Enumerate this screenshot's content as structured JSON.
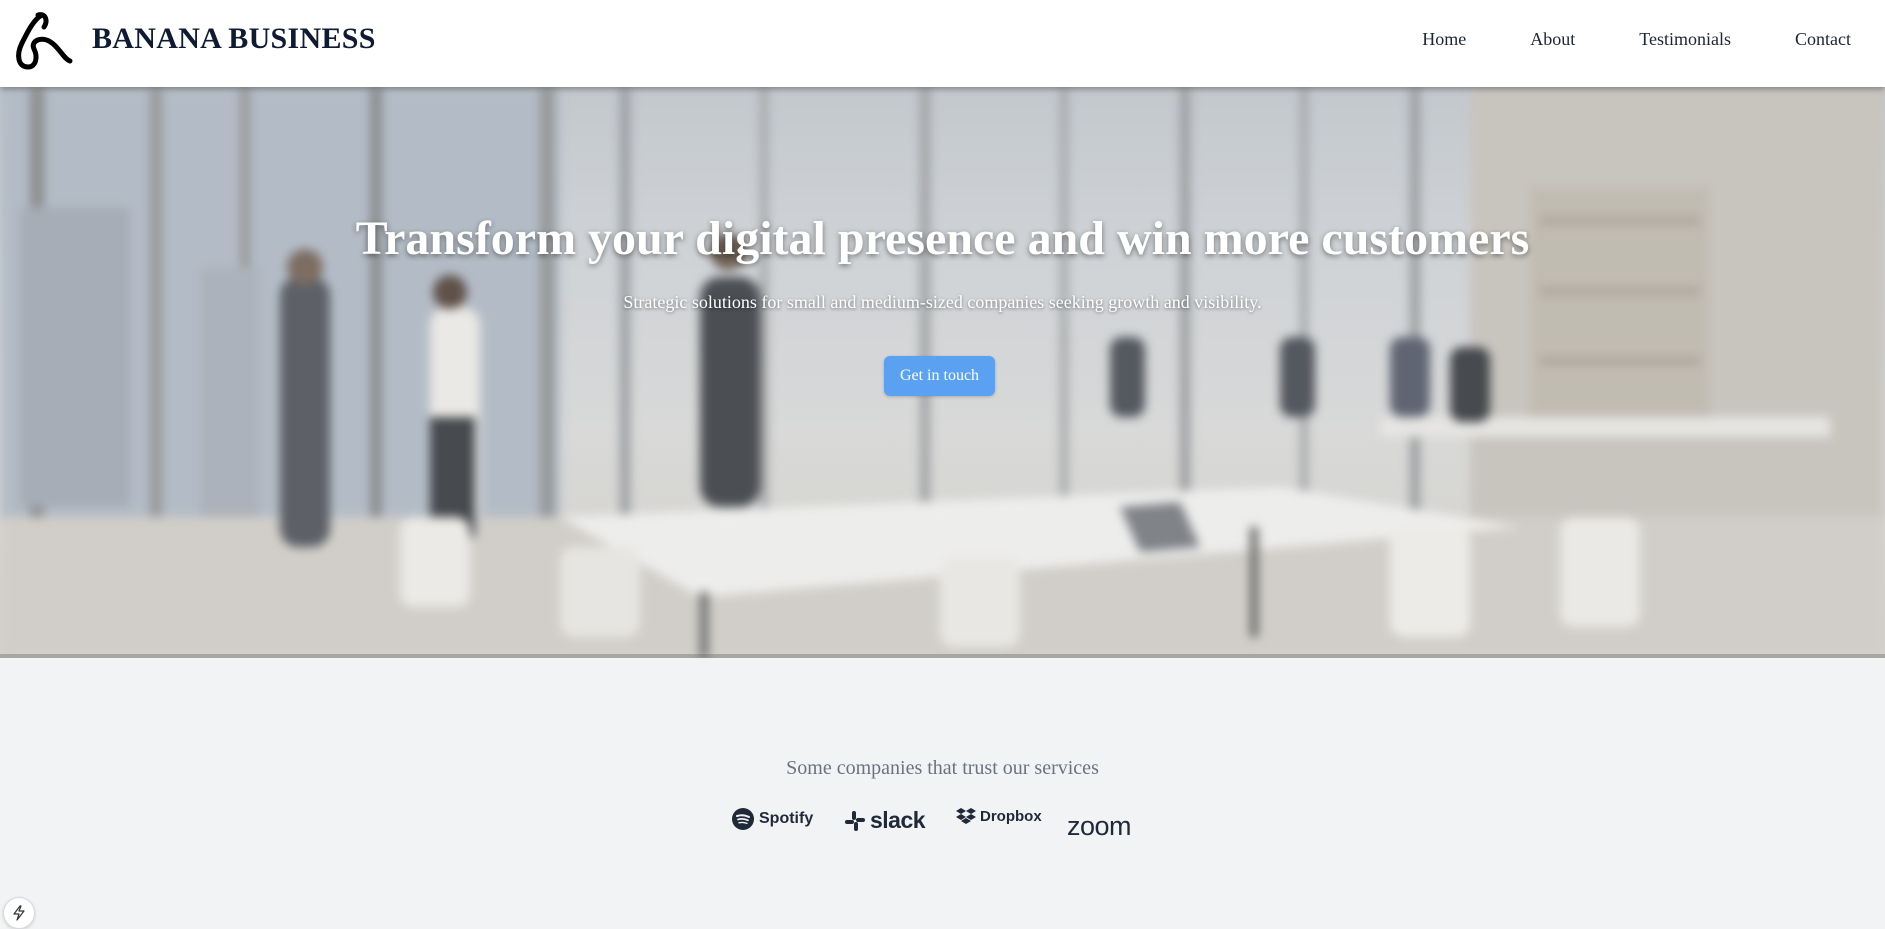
{
  "header": {
    "brand": "BANANA BUSINESS",
    "logo_icon": "banana-icon",
    "nav": [
      {
        "label": "Home"
      },
      {
        "label": "About"
      },
      {
        "label": "Testimonials"
      },
      {
        "label": "Contact"
      }
    ]
  },
  "hero": {
    "title": "Transform your digital presence and win more customers",
    "subtitle": "Strategic solutions for small and medium-sized companies seeking growth and visibility.",
    "cta_label": "Get in touch",
    "cta_color": "#5aa1f2"
  },
  "trust": {
    "label": "Some companies that trust our services",
    "logos": [
      {
        "name": "Spotify",
        "icon": "spotify-icon"
      },
      {
        "name": "slack",
        "icon": "slack-icon"
      },
      {
        "name": "Dropbox",
        "icon": "dropbox-icon"
      },
      {
        "name": "zoom",
        "icon": "zoom-icon"
      }
    ]
  },
  "corner_badge_icon": "bolt-icon"
}
